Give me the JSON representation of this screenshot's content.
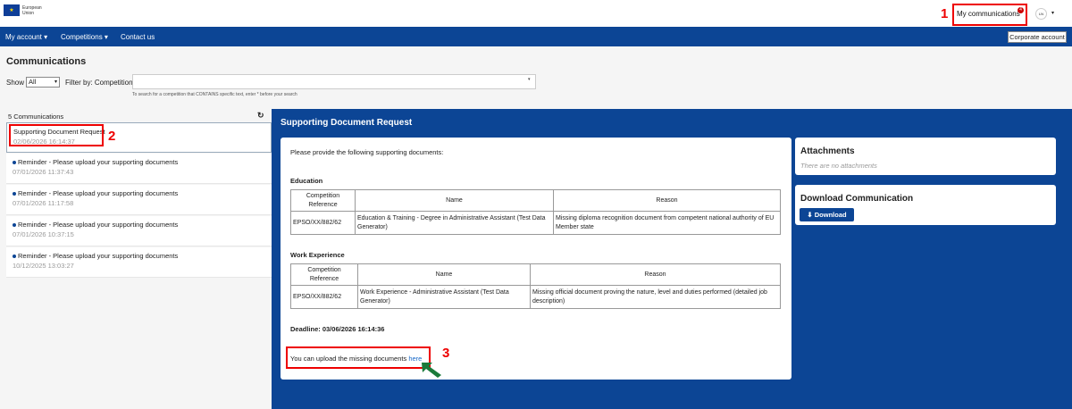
{
  "header": {
    "logo_text_line1": "European",
    "logo_text_line2": "Union",
    "my_communications": "My communications",
    "badge_count": "4",
    "lang": "LN",
    "caret": "▾"
  },
  "nav": {
    "my_account": "My account ▾",
    "competitions": "Competitions ▾",
    "contact": "Contact us",
    "corporate": "Corporate account"
  },
  "page": {
    "title": "Communications",
    "show_label": "Show",
    "show_value": "All",
    "filter_label": "Filter by:  Competition",
    "hint": "To search for a competition that CONTAINS specific text, enter * before your search",
    "input_caret": "▾"
  },
  "list": {
    "count": "5 Communications",
    "refresh": "↻",
    "items": [
      {
        "title": "Supporting Document Request",
        "date": "02/06/2026 16:14:37"
      },
      {
        "title": "Reminder - Please upload your supporting documents",
        "date": "07/01/2026 11:37:43"
      },
      {
        "title": "Reminder - Please upload your supporting documents",
        "date": "07/01/2026 11:17:58"
      },
      {
        "title": "Reminder - Please upload your supporting documents",
        "date": "07/01/2026 10:37:15"
      },
      {
        "title": "Reminder - Please upload your supporting documents",
        "date": "10/12/2025 13:03:27"
      }
    ]
  },
  "detail": {
    "title": "Supporting Document Request",
    "intro": "Please provide the following supporting documents:",
    "education_heading": "Education",
    "work_heading": "Work Experience",
    "col_ref": "Competition Reference",
    "col_name": "Name",
    "col_reason": "Reason",
    "edu_row": {
      "ref": "EPSO/XX/882/62",
      "name": "Education & Training - Degree in Administrative Assistant (Test Data Generator)",
      "reason": "Missing diploma recognition document from competent national authority of EU Member state"
    },
    "work_row": {
      "ref": "EPSO/XX/882/62",
      "name": "Work Experience - Administrative Assistant (Test Data Generator)",
      "reason": "Missing official document proving the nature, level and duties performed (detailed job description)"
    },
    "deadline": "Deadline: 03/06/2026 16:14:36",
    "upload_text": "You can upload the missing documents ",
    "upload_link": "here"
  },
  "attachments": {
    "title": "Attachments",
    "empty": "There are no attachments"
  },
  "download": {
    "title": "Download Communication",
    "button": "⬇ Download"
  },
  "annotations": {
    "n1": "1",
    "n2": "2",
    "n3": "3"
  },
  "colors": {
    "navy": "#0c4595",
    "annotation_red": "#e00000",
    "arrow_green": "#1a7a3a"
  }
}
